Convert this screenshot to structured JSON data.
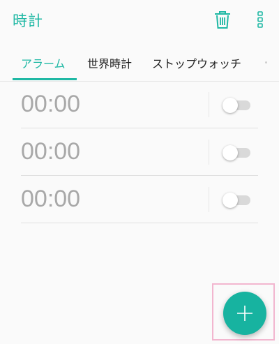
{
  "app": {
    "title": "時計"
  },
  "toolbar": {
    "delete_icon": "trash-icon",
    "more_icon": "more-vertical-icon"
  },
  "tabs": [
    {
      "label": "アラーム",
      "active": true
    },
    {
      "label": "世界時計",
      "active": false
    },
    {
      "label": "ストップウォッチ",
      "active": false
    }
  ],
  "alarms": [
    {
      "time": "00:00",
      "enabled": false
    },
    {
      "time": "00:00",
      "enabled": false
    },
    {
      "time": "00:00",
      "enabled": false
    }
  ],
  "fab": {
    "icon": "plus-icon"
  },
  "colors": {
    "accent": "#1fb8a4",
    "fab": "#17b3a0",
    "time_text": "#a8a8a8"
  }
}
